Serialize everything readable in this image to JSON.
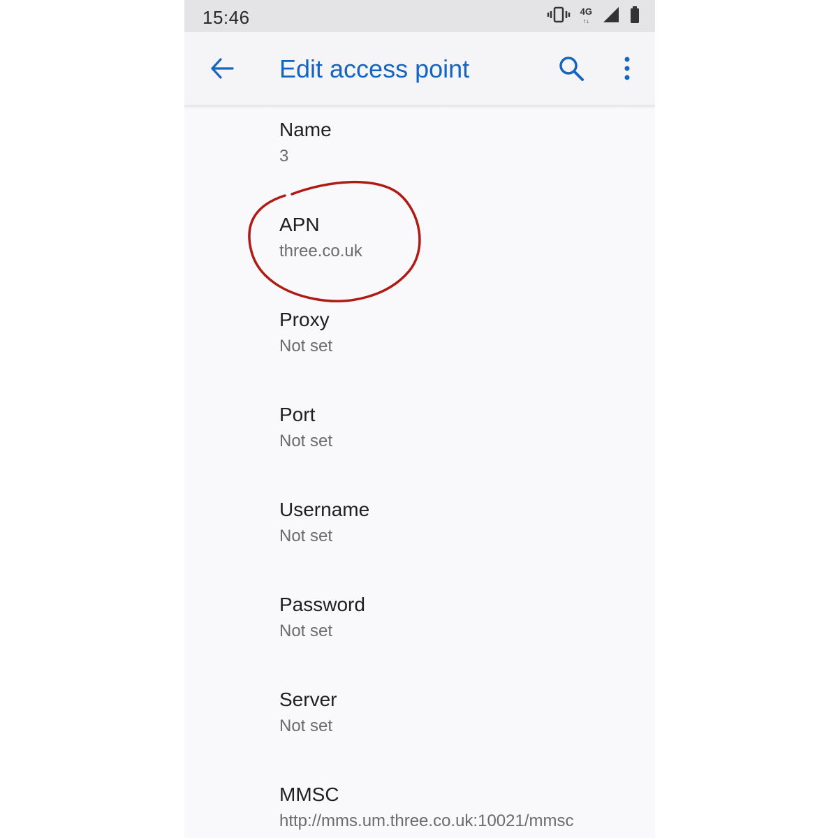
{
  "status_bar": {
    "time": "15:46",
    "network_type": "4G",
    "icons": [
      "vibrate-icon",
      "network-type-icon",
      "signal-icon",
      "battery-icon"
    ]
  },
  "toolbar": {
    "title": "Edit access point",
    "back_icon": "arrow-left-icon",
    "search_icon": "search-icon",
    "more_icon": "more-vert-icon"
  },
  "preferences": [
    {
      "title": "Name",
      "summary": "3"
    },
    {
      "title": "APN",
      "summary": "three.co.uk"
    },
    {
      "title": "Proxy",
      "summary": "Not set"
    },
    {
      "title": "Port",
      "summary": "Not set"
    },
    {
      "title": "Username",
      "summary": "Not set"
    },
    {
      "title": "Password",
      "summary": "Not set"
    },
    {
      "title": "Server",
      "summary": "Not set"
    },
    {
      "title": "MMSC",
      "summary": "http://mms.um.three.co.uk:10021/mmsc"
    }
  ],
  "colors": {
    "accent": "#1565c0",
    "annotation": "#b01a14",
    "background": "#f9f8fa",
    "status_bar": "#e4e4e6"
  }
}
